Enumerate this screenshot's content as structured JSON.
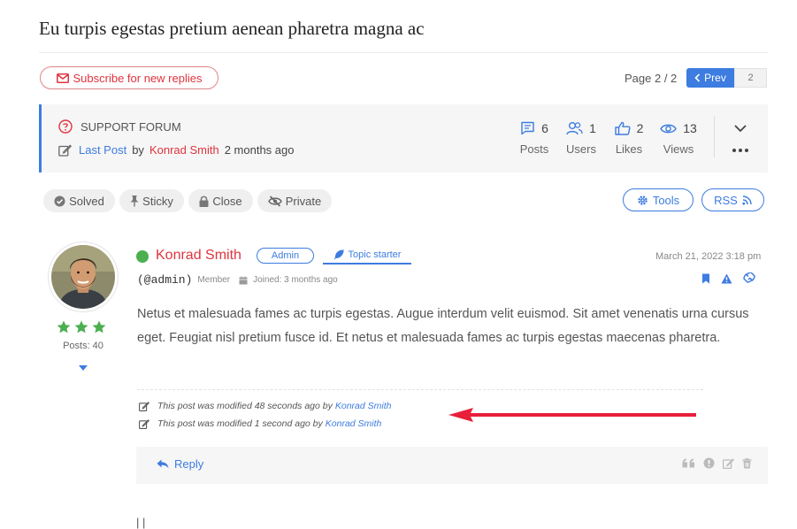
{
  "topic": {
    "title": "Eu turpis egestas pretium aenean pharetra magna ac"
  },
  "subscribe": {
    "label": "Subscribe for new replies",
    "icon": "envelope-icon"
  },
  "pagination": {
    "label": "Page 2 / 2",
    "prev_label": "Prev",
    "pages": [
      "2"
    ],
    "current": "2"
  },
  "info": {
    "forum_label": "SUPPORT FORUM",
    "last_post_label": "Last Post",
    "by_label": "by",
    "last_post_author": "Konrad Smith",
    "last_post_time": "2 months ago"
  },
  "stats": [
    {
      "value": "6",
      "label": "Posts",
      "icon": "posts-icon"
    },
    {
      "value": "1",
      "label": "Users",
      "icon": "users-icon"
    },
    {
      "value": "2",
      "label": "Likes",
      "icon": "thumbs-up-icon"
    },
    {
      "value": "13",
      "label": "Views",
      "icon": "eye-icon"
    }
  ],
  "topic_actions": {
    "solved": "Solved",
    "sticky": "Sticky",
    "close": "Close",
    "private": "Private",
    "tools": "Tools",
    "rss": "RSS"
  },
  "post": {
    "author": "Konrad Smith",
    "role_badge": "Admin",
    "starter_badge": "Topic starter",
    "handle": "(@admin)",
    "member_label": "Member",
    "joined": "Joined: 3 months ago",
    "date": "March 21, 2022 3:18 pm",
    "posts_count": "Posts: 40",
    "rating_stars": 3,
    "body": "Netus et malesuada fames ac turpis egestas. Augue interdum velit euismod. Sit amet venenatis urna cursus eget. Feugiat nisl pretium fusce id. Et netus et malesuada fames ac turpis egestas maecenas pharetra.",
    "modifications": [
      {
        "text": "This post was modified 48 seconds ago by",
        "author": "Konrad Smith"
      },
      {
        "text": "This post was modified 1 second ago by",
        "author": "Konrad Smith"
      }
    ],
    "reply_label": "Reply"
  },
  "partial_next": {
    "text": "|          |"
  },
  "colors": {
    "accent": "#3d7ce0",
    "brand_red": "#e0343e",
    "online": "#4caf50",
    "star": "#4caf50",
    "annotation_arrow": "#e8203a"
  }
}
